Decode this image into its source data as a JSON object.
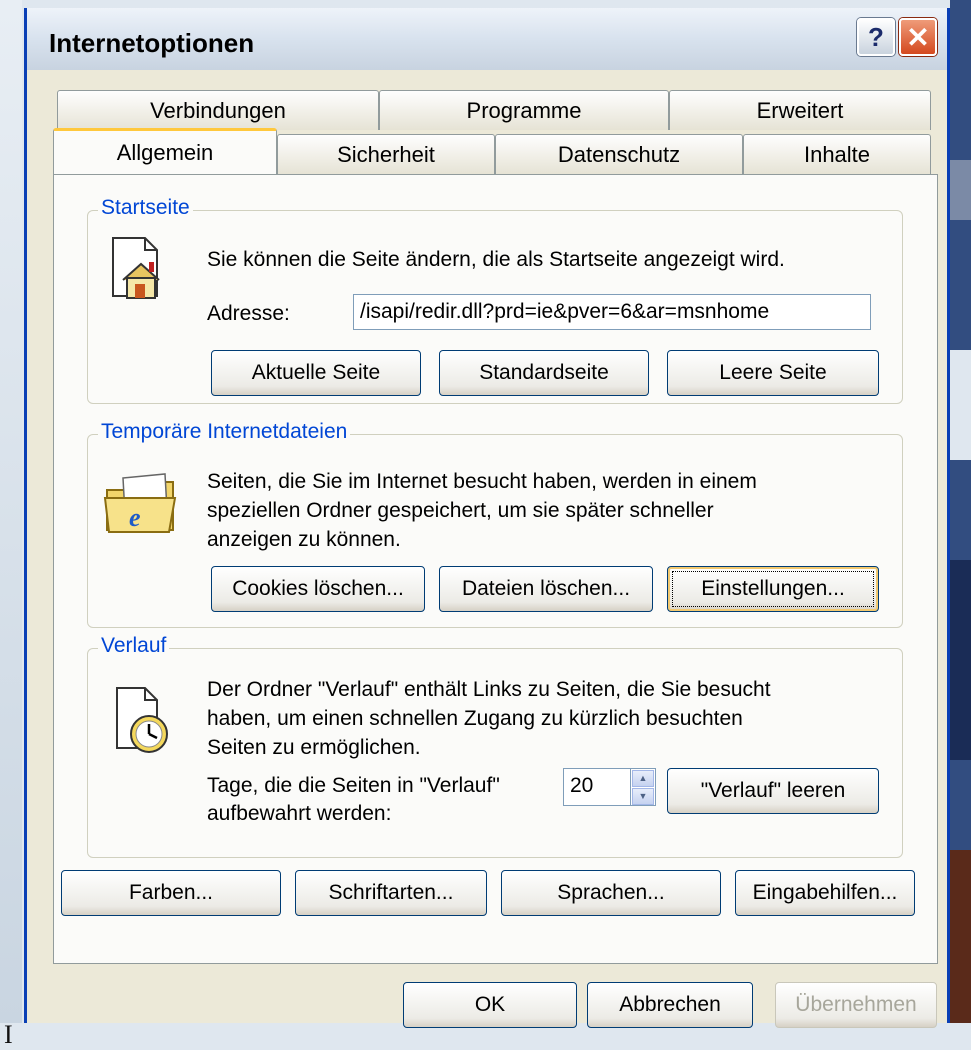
{
  "window": {
    "title": "Internetoptionen",
    "help_label": "?",
    "close_label": "✕"
  },
  "tabs_back": [
    "Verbindungen",
    "Programme",
    "Erweitert"
  ],
  "tabs_front": [
    "Allgemein",
    "Sicherheit",
    "Datenschutz",
    "Inhalte"
  ],
  "startseite": {
    "label": "Startseite",
    "desc": "Sie können die Seite ändern, die als Startseite angezeigt wird.",
    "address_label": "Adresse:",
    "address_value": "/isapi/redir.dll?prd=ie&pver=6&ar=msnhome",
    "buttons": [
      "Aktuelle Seite",
      "Standardseite",
      "Leere Seite"
    ]
  },
  "temp": {
    "label": "Temporäre Internetdateien",
    "desc_lines": [
      "Seiten, die Sie im Internet besucht haben, werden in einem",
      "speziellen Ordner gespeichert, um sie später schneller",
      "anzeigen zu können."
    ],
    "buttons": [
      "Cookies löschen...",
      "Dateien löschen...",
      "Einstellungen..."
    ]
  },
  "verlauf": {
    "label": "Verlauf",
    "desc_lines": [
      "Der Ordner \"Verlauf\" enthält Links zu Seiten, die Sie besucht",
      "haben, um einen schnellen Zugang zu kürzlich besuchten",
      "Seiten zu ermöglichen."
    ],
    "days_label_lines": [
      "Tage, die die Seiten in \"Verlauf\"",
      "aufbewahrt werden:"
    ],
    "days_value": "20",
    "clear_button": "\"Verlauf\" leeren"
  },
  "bottom_buttons": [
    "Farben...",
    "Schriftarten...",
    "Sprachen...",
    "Eingabehilfen..."
  ],
  "dialog_buttons": [
    "OK",
    "Abbrechen",
    "Übernehmen"
  ],
  "background": {
    "left_text": "I"
  },
  "colors": {
    "titlebar_border": "#0a3fb5",
    "group_label": "#0046d5",
    "active_tab": "#ffc83c",
    "dialog_bg": "#ece9d8"
  },
  "icons": [
    "home-page-icon",
    "ie-folder-icon",
    "history-clock-icon"
  ]
}
